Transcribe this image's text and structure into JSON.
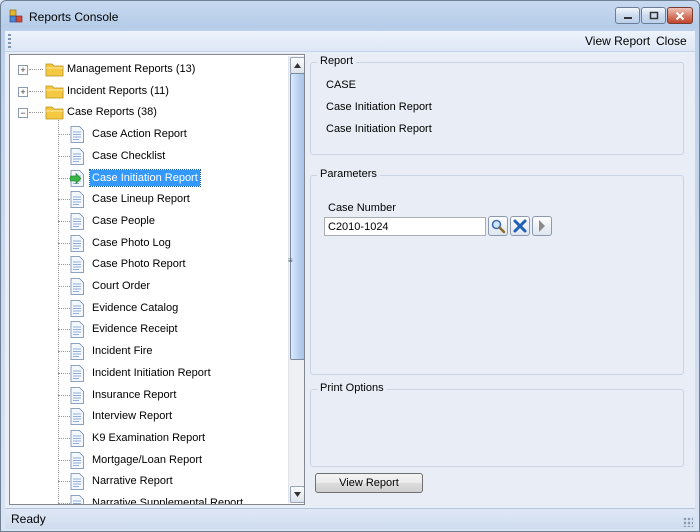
{
  "window": {
    "title": "Reports Console"
  },
  "menu": {
    "items": [
      "View Report",
      "Close"
    ]
  },
  "tree": {
    "groups": [
      {
        "label": "Management  Reports (13)",
        "expanded": false
      },
      {
        "label": "Incident  Reports (11)",
        "expanded": false
      },
      {
        "label": "Case Reports (38)",
        "expanded": true
      }
    ],
    "case_reports": [
      "Case Action Report",
      "Case Checklist",
      "Case Initiation Report",
      "Case Lineup Report",
      "Case People",
      "Case Photo Log",
      "Case Photo Report",
      "Court Order",
      "Evidence Catalog",
      "Evidence Receipt",
      "Incident Fire",
      "Incident Initiation Report",
      "Insurance Report",
      "Interview Report",
      "K9 Examination Report",
      "Mortgage/Loan Report",
      "Narrative Report",
      "Narrative Supplemental Report"
    ],
    "selected": "Case Initiation Report"
  },
  "report": {
    "title": "Report",
    "module": "CASE",
    "name": "Case Initiation Report",
    "description": "Case Initiation Report"
  },
  "parameters": {
    "title": "Parameters",
    "case_number_label": "Case Number",
    "case_number_value": "C2010-1024"
  },
  "print_options": {
    "title": "Print Options"
  },
  "view_button_label": "View Report",
  "status": {
    "text": "Ready"
  },
  "colors": {
    "selection": "#3399ff",
    "folder": "#f5c842",
    "window_frame": "#bcd0ea"
  }
}
